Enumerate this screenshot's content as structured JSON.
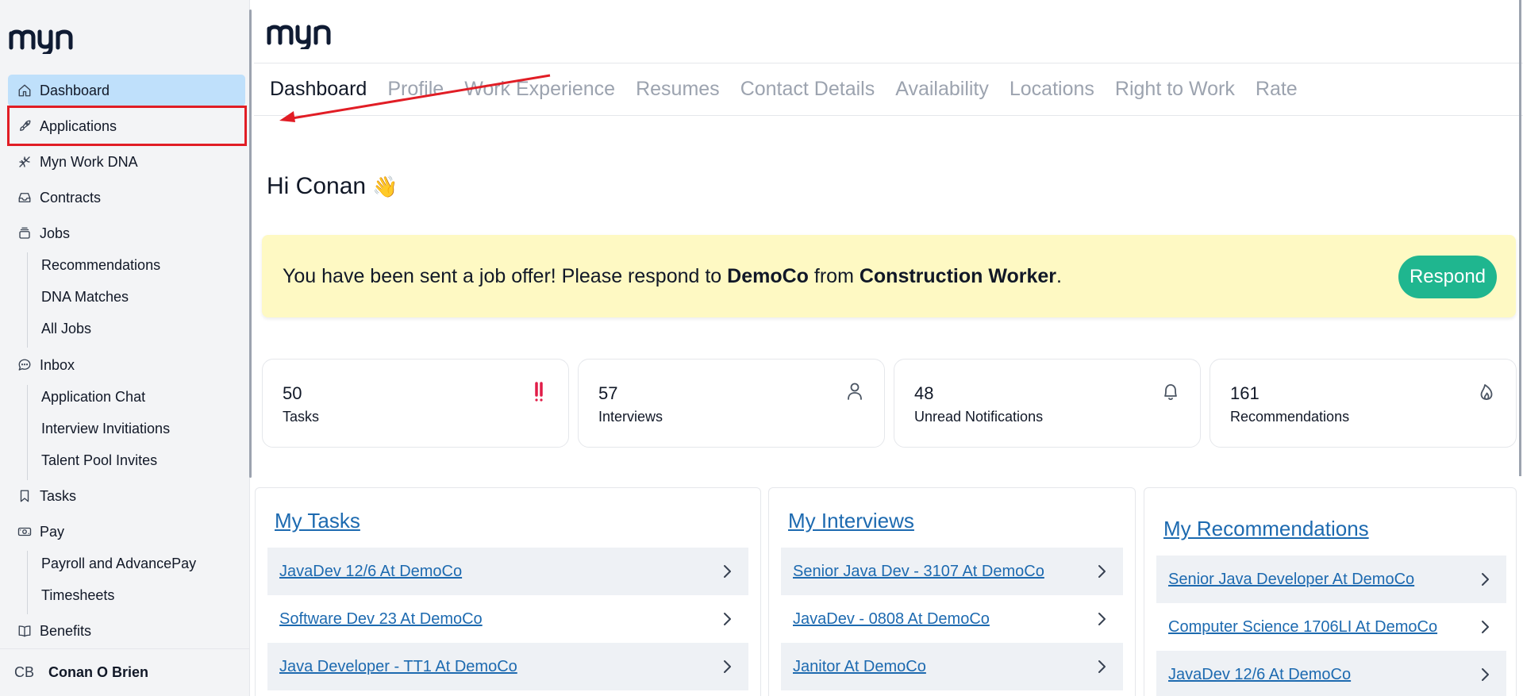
{
  "app": {
    "logo_text": "myn"
  },
  "sidebar": {
    "items": [
      {
        "label": "Dashboard",
        "icon": "home-icon"
      },
      {
        "label": "Applications",
        "icon": "rocket-icon"
      },
      {
        "label": "Myn Work DNA",
        "icon": "dna-icon"
      },
      {
        "label": "Contracts",
        "icon": "inbox-tray-icon"
      },
      {
        "label": "Jobs",
        "icon": "stack-icon"
      },
      {
        "label": "Inbox",
        "icon": "chat-bubble-icon"
      },
      {
        "label": "Tasks",
        "icon": "bookmark-icon"
      },
      {
        "label": "Pay",
        "icon": "cash-icon"
      },
      {
        "label": "Benefits",
        "icon": "book-icon"
      }
    ],
    "jobs_sub": [
      "Recommendations",
      "DNA Matches",
      "All Jobs"
    ],
    "inbox_sub": [
      "Application Chat",
      "Interview Invitiations",
      "Talent Pool Invites"
    ],
    "pay_sub": [
      "Payroll and AdvancePay",
      "Timesheets"
    ],
    "user": {
      "initials": "CB",
      "name": "Conan O Brien"
    }
  },
  "tabs": [
    "Dashboard",
    "Profile",
    "Work Experience",
    "Resumes",
    "Contact Details",
    "Availability",
    "Locations",
    "Right to Work",
    "Rate"
  ],
  "greeting": {
    "text": "Hi Conan",
    "emoji": "👋"
  },
  "offer": {
    "prefix": "You have been sent a job offer! Please respond to ",
    "company": "DemoCo",
    "middle": " from ",
    "role": "Construction Worker",
    "suffix": ".",
    "button": "Respond"
  },
  "stats": [
    {
      "value": "50",
      "label": "Tasks",
      "icon": "double-exclamation-icon"
    },
    {
      "value": "57",
      "label": "Interviews",
      "icon": "person-icon"
    },
    {
      "value": "48",
      "label": "Unread Notifications",
      "icon": "bell-icon"
    },
    {
      "value": "161",
      "label": "Recommendations",
      "icon": "flame-icon"
    }
  ],
  "cards": {
    "tasks": {
      "title": "My Tasks",
      "rows": [
        "JavaDev 12/6 At DemoCo",
        "Software Dev 23 At DemoCo",
        "Java Developer - TT1 At DemoCo"
      ]
    },
    "interviews": {
      "title": "My Interviews",
      "rows": [
        "Senior Java Dev - 3107 At DemoCo",
        "JavaDev - 0808 At DemoCo",
        "Janitor At DemoCo"
      ]
    },
    "recommendations": {
      "title": "My Recommendations",
      "rows": [
        "Senior Java Developer At DemoCo",
        "Computer Science 1706LI At DemoCo",
        "JavaDev 12/6 At DemoCo"
      ]
    }
  },
  "colors": {
    "accent": "#1fb68f",
    "link": "#1d6ab0",
    "active_nav": "#bfe0fb",
    "offer_bg": "#fef9c3",
    "annotation": "#e11d25",
    "alert": "#e11d48"
  }
}
